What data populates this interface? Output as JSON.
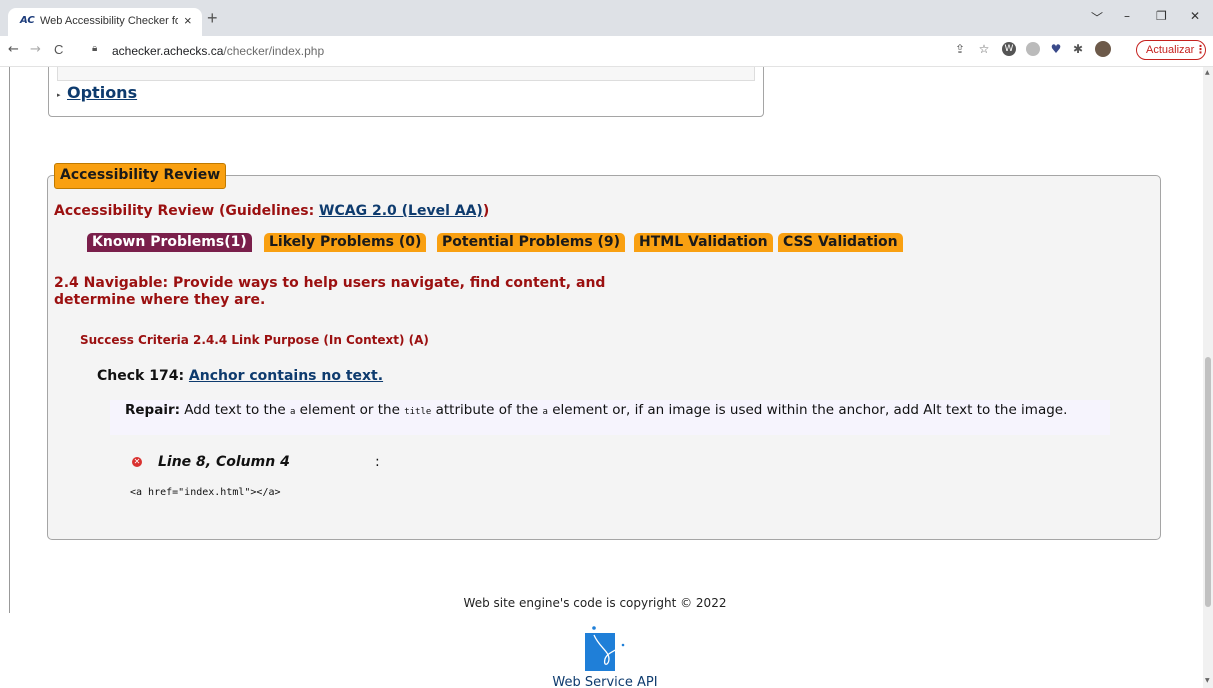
{
  "browser": {
    "tab_favicon": "AC",
    "tab_title": "Web Accessibility Checker for W…",
    "tab_close": "×",
    "new_tab": "+",
    "url_host": "achecker.achecks.ca",
    "url_path": "/checker/index.php",
    "update_label": "Actualizar",
    "update_dots": "⋮",
    "win_controls": [
      "﹀",
      "–",
      "❐",
      "✕"
    ],
    "nav": {
      "back": "←",
      "forward": "→",
      "reload": "C"
    }
  },
  "options": {
    "label": "Options",
    "arrow": "▸"
  },
  "review": {
    "legend": "Accessibility Review",
    "guidelines_prefix": "Accessibility Review (Guidelines: ",
    "guidelines_link": "WCAG 2.0 (Level AA)",
    "guidelines_suffix": ")",
    "tabs": [
      {
        "label": "Known Problems(1)",
        "active": true
      },
      {
        "label": "Likely Problems (0)",
        "active": false
      },
      {
        "label": "Potential Problems (9)",
        "active": false
      },
      {
        "label": "HTML Validation",
        "active": false
      },
      {
        "label": "CSS Validation",
        "active": false
      }
    ],
    "principle": "2.4 Navigable: Provide ways to help users navigate, find content, and determine where they are.",
    "success_criteria": "Success Criteria 2.4.4 Link Purpose (In Context) (A)",
    "check_prefix": "Check 174: ",
    "check_link": "Anchor contains no text.",
    "repair": {
      "label": "Repair:",
      "text1": " Add text to the ",
      "code1": "a",
      "text2": " element or the ",
      "code2": "title",
      "text3": " attribute of the ",
      "code3": "a",
      "text4": " element or, if an image is used within the anchor, add Alt text to the image."
    },
    "location": "Line 8, Column 4",
    "location_suffix": ":",
    "code_snippet": "<a href=\"index.html\"></a>"
  },
  "footer": {
    "copyright": "Web site engine's code is copyright © 2022",
    "api_label": "Web Service API"
  },
  "colors": {
    "accent_orange": "#f9a011",
    "active_tab": "#7a1f4b",
    "heading_red": "#9b1010",
    "link_blue": "#0e3b6e"
  }
}
